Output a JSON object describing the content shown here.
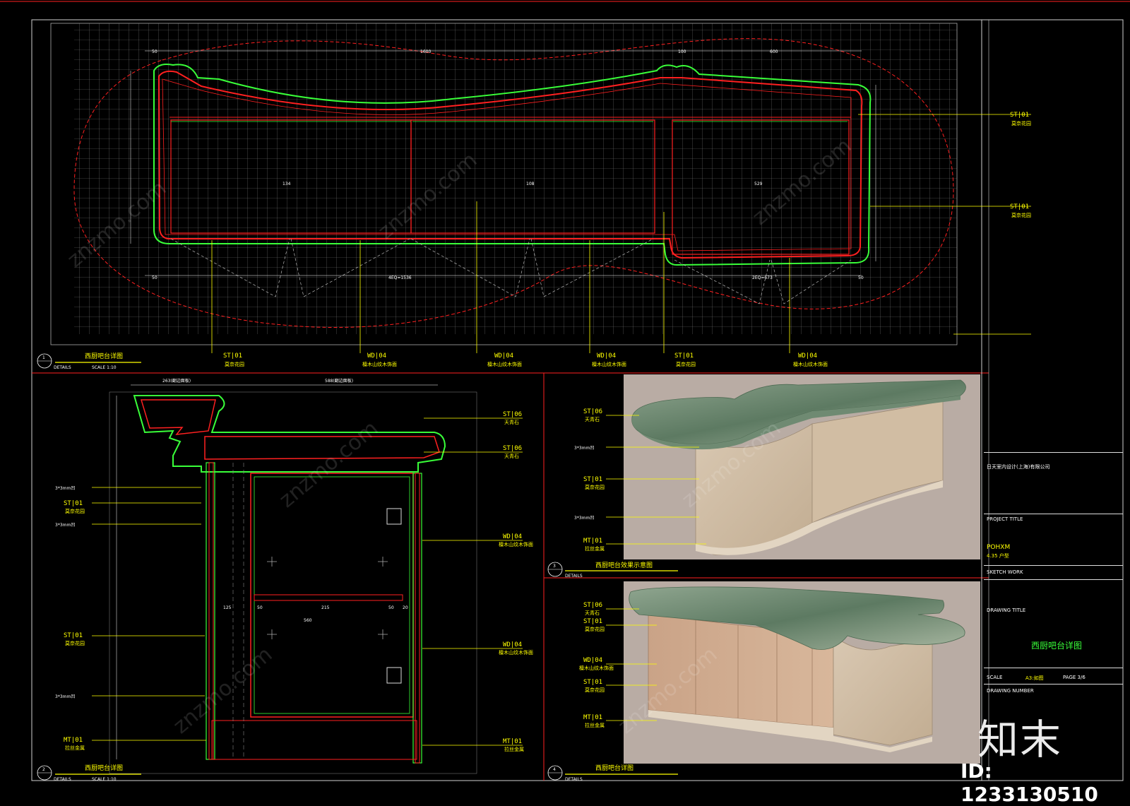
{
  "views": {
    "v1": {
      "num": "1",
      "title": "西厨吧台详图",
      "details": "DETAILS",
      "scale": "SCALE 1:10"
    },
    "v2": {
      "num": "2",
      "title": "西厨吧台详图",
      "details": "DETAILS",
      "scale": "SCALE 1:10"
    },
    "v3": {
      "num": "3",
      "title": "西厨吧台效果示意图",
      "details": "DETAILS"
    },
    "v4": {
      "num": "4",
      "title": "西厨吧台详图",
      "details": "DETAILS"
    }
  },
  "plan_tags": [
    {
      "code": "ST|01",
      "name": "莫奈花园"
    },
    {
      "code": "WD|04",
      "name": "檀木山纹木饰面"
    },
    {
      "code": "WD|04",
      "name": "檀木山纹木饰面"
    },
    {
      "code": "WD|04",
      "name": "檀木山纹木饰面"
    },
    {
      "code": "ST|01",
      "name": "莫奈花园"
    },
    {
      "code": "WD|04",
      "name": "檀木山纹木饰面"
    }
  ],
  "plan_right_tags": [
    {
      "code": "ST|01",
      "name": "莫奈花园"
    },
    {
      "code": "ST|01",
      "name": "莫奈花园"
    }
  ],
  "plan_dims": [
    "1600",
    "50",
    "100",
    "100",
    "600",
    "50",
    "54",
    "134",
    "108",
    "529",
    "4EQ=1536",
    "2EQ=673",
    "50",
    "50"
  ],
  "section_left_tags": [
    {
      "code": "3*3mm凹",
      "name": ""
    },
    {
      "code": "ST|01",
      "name": "莫奈花园"
    },
    {
      "code": "3*3mm凹",
      "name": ""
    },
    {
      "code": "ST|01",
      "name": "莫奈花园"
    },
    {
      "code": "3*3mm凹",
      "name": ""
    },
    {
      "code": "MT|01",
      "name": "拉丝金属"
    }
  ],
  "section_right_tags": [
    {
      "code": "ST|06",
      "name": "天青石"
    },
    {
      "code": "ST|06",
      "name": "天青石"
    },
    {
      "code": "WD|04",
      "name": "檀木山纹木饰面"
    },
    {
      "code": "WD|04",
      "name": "檀木山纹木饰面"
    },
    {
      "code": "MT|01",
      "name": "拉丝金属"
    }
  ],
  "section_top_dims": [
    "263(翻边面板)",
    "588(翻边面板)"
  ],
  "section_inner_dims": [
    "560",
    "50",
    "215",
    "50",
    "20",
    "125"
  ],
  "render_tags_top": [
    {
      "code": "ST|06",
      "name": "天青石"
    },
    {
      "code": "3*3mm凹",
      "name": ""
    },
    {
      "code": "ST|01",
      "name": "莫奈花园"
    },
    {
      "code": "3*3mm凹",
      "name": ""
    },
    {
      "code": "MT|01",
      "name": "拉丝金属"
    }
  ],
  "render_tags_bottom": [
    {
      "code": "ST|06",
      "name": "天青石"
    },
    {
      "code": "ST|01",
      "name": "莫奈花园"
    },
    {
      "code": "WD|04",
      "name": "檀木山纹木饰面"
    },
    {
      "code": "ST|01",
      "name": "莫奈花园"
    },
    {
      "code": "MT|01",
      "name": "拉丝金属"
    }
  ],
  "title_block": {
    "company": "日天室内设计(上海)有限公司",
    "project_title": "PROJECT TITLE",
    "project_code": "POHXM",
    "project_sub": "4.35 户型",
    "artwork": "SKETCH WORK",
    "drawing_title_label": "DRAWING TITLE",
    "drawing_title": "西厨吧台详图",
    "scale_label": "SCALE",
    "scale_value": "A3:如图",
    "page": "PAGE 3/6",
    "drawing_number": "DRAWING NUMBER"
  },
  "brand": "知末",
  "id_label": "ID: 1233130510",
  "watermark": "znzmo.com",
  "colors": {
    "green": "#39ff39",
    "red": "#ff2020",
    "yellow": "#ffff00",
    "grid": "#8a8a8a",
    "white": "#ffffff"
  }
}
